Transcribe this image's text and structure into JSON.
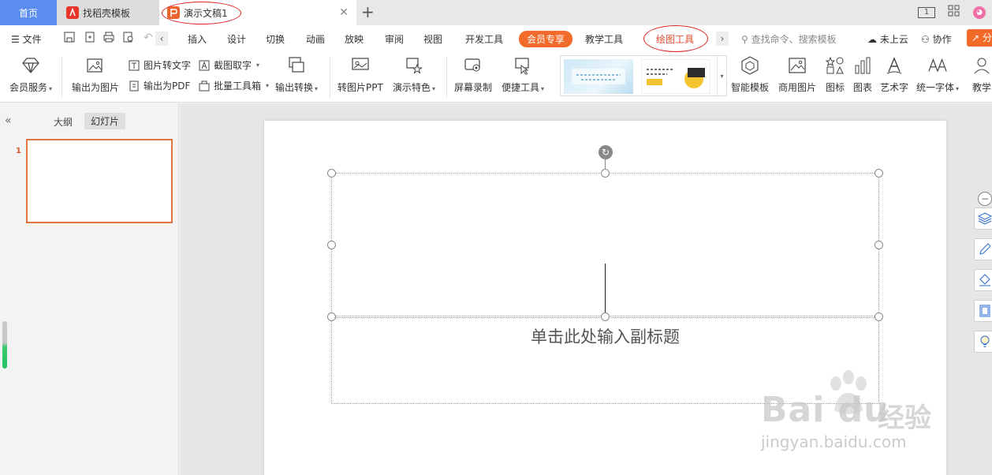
{
  "tabs": {
    "home": "首页",
    "template": "找稻壳模板",
    "document": "演示文稿1",
    "add": "+"
  },
  "window_right": {
    "layout_badge": "1"
  },
  "menu": {
    "file": "文件",
    "items": [
      "插入",
      "设计",
      "切换",
      "动画",
      "放映",
      "审阅",
      "视图",
      "开发工具"
    ],
    "vip": "会员专享",
    "teaching": "教学工具",
    "drawing": "绘图工具",
    "search_placeholder": "查找命令、搜索模板",
    "cloud": "未上云",
    "collab": "协作",
    "share": "分"
  },
  "ribbon": {
    "vip_service": "会员服务",
    "export_image": "输出为图片",
    "pic_to_text": "图片转文字",
    "export_pdf": "输出为PDF",
    "screenshot_text": "截图取字",
    "batch_tools": "批量工具箱",
    "export_convert": "输出转换",
    "pic_to_ppt": "转图片PPT",
    "special_effects": "演示特色",
    "screen_record": "屏幕录制",
    "quick_tools": "便捷工具",
    "smart_template": "智能模板",
    "stock_image": "商用图片",
    "icon": "图标",
    "chart": "图表",
    "art_text": "艺术字",
    "unify_font": "统一字体",
    "teaching_partial": "教学"
  },
  "left_panel": {
    "outline": "大纲",
    "slides": "幻灯片",
    "slide_number": "1"
  },
  "slide": {
    "subtitle_placeholder": "单击此处输入副标题"
  },
  "watermark": {
    "logo": "Bai du",
    "cn": "经验",
    "url": "jingyan.baidu.com"
  },
  "colors": {
    "home_tab": "#5b8def",
    "accent_orange": "#f36b2a",
    "drawing_tools_text": "#e34d2f",
    "annotation_ellipse": "#dd2222",
    "slide_thumb_border": "#e0753f"
  }
}
